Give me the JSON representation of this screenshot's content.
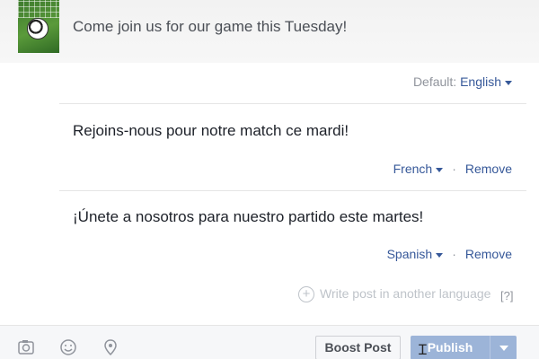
{
  "post": {
    "text": "Come join us for our game this Tuesday!",
    "default_label": "Default:",
    "default_language": "English"
  },
  "translations": [
    {
      "text": "Rejoins-nous pour notre match ce mardi!",
      "language": "French",
      "remove_label": "Remove"
    },
    {
      "text": "¡Únete a nosotros para nuestro partido este martes!",
      "language": "Spanish",
      "remove_label": "Remove"
    }
  ],
  "add_language": {
    "label": "Write post in another language",
    "help": "[?]"
  },
  "footer": {
    "icons": [
      "camera-icon",
      "smiley-icon",
      "location-pin-icon"
    ],
    "boost_label": "Boost Post",
    "publish_label": "Publish"
  },
  "colors": {
    "link": "#365899",
    "publish_disabled": "#9cb4d8",
    "muted": "#90949c"
  }
}
